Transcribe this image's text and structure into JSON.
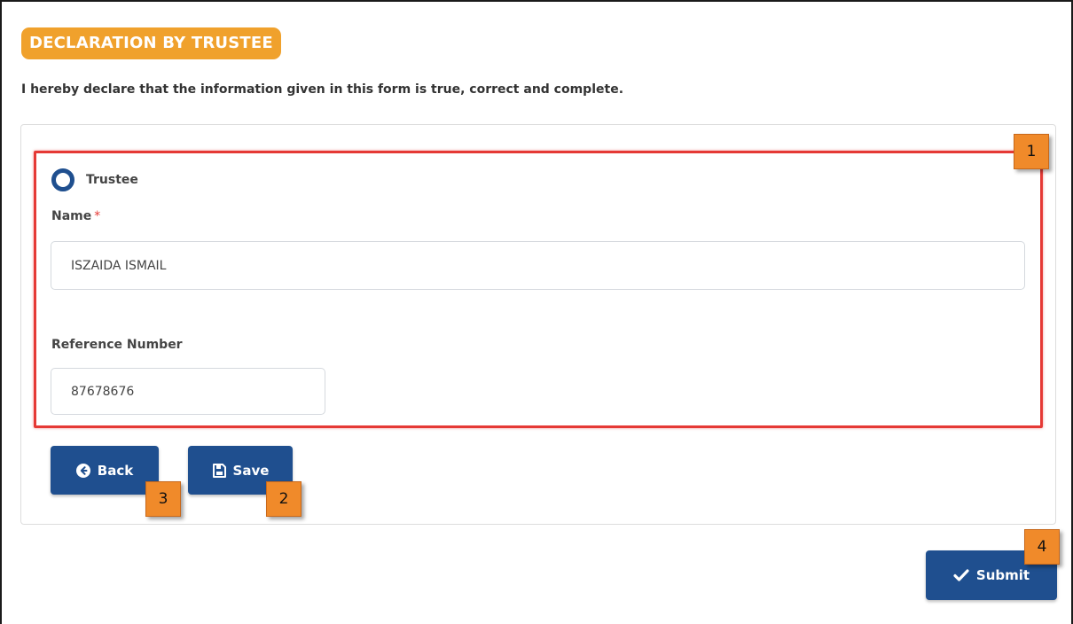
{
  "section": {
    "title": "DECLARATION BY TRUSTEE"
  },
  "declaration": {
    "text": "I hereby declare that the information given in this form is true, correct and complete."
  },
  "form": {
    "role_option": {
      "label": "Trustee",
      "selected": true
    },
    "name": {
      "label": "Name",
      "required_mark": "*",
      "value": "ISZAIDA ISMAIL"
    },
    "reference": {
      "label": "Reference Number",
      "value": "87678676"
    }
  },
  "buttons": {
    "back": "Back",
    "save": "Save",
    "submit": "Submit"
  },
  "markers": {
    "m1": "1",
    "m2": "2",
    "m3": "3",
    "m4": "4"
  },
  "colors": {
    "accent_orange": "#f0a12c",
    "primary_blue": "#1f4f8f",
    "highlight_red": "#e53935",
    "marker_orange": "#f08a2a"
  }
}
